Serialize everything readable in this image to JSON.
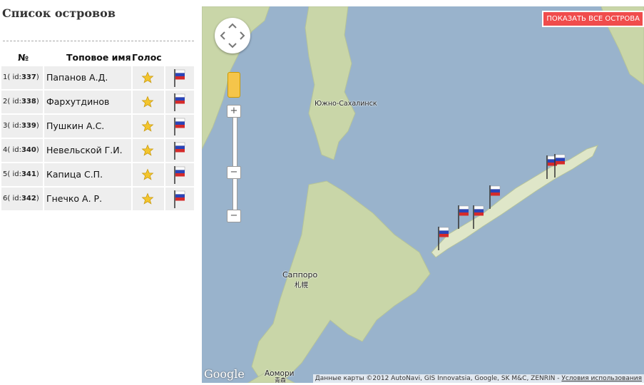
{
  "sidebar": {
    "title": "Список островов",
    "headers": {
      "num": "№",
      "name": "Топовое имя",
      "vote": "Голос"
    },
    "rows": [
      {
        "index": "1",
        "id": "337",
        "name": "Папанов А.Д."
      },
      {
        "index": "2",
        "id": "338",
        "name": "Фархутдинов И.П."
      },
      {
        "index": "3",
        "id": "339",
        "name": "Пушкин А.С."
      },
      {
        "index": "4",
        "id": "340",
        "name": "Невельской Г.И."
      },
      {
        "index": "5",
        "id": "341",
        "name": "Капица С.П."
      },
      {
        "index": "6",
        "id": "342",
        "name": "Гнечко А. Р."
      }
    ]
  },
  "map": {
    "show_all_label": "ПОКАЗАТЬ ВСЕ ОСТРОВА",
    "labels": {
      "sakhalinsk": "Южно-Сахалинск",
      "sapporo": "Саппоро",
      "sapporo_jp": "札幌",
      "aomori": "Аомори",
      "aomori_jp": "青森"
    },
    "logo": "Google",
    "attribution": "Данные карты ©2012 AutoNavi, GIS Innovatsia, Google, SK M&C, ZENRIN -",
    "terms_link": "Условия использования",
    "colors": {
      "water": "#99b3cc",
      "land": "#c9d6a8",
      "show_all_bg": "#f04c4c"
    }
  }
}
